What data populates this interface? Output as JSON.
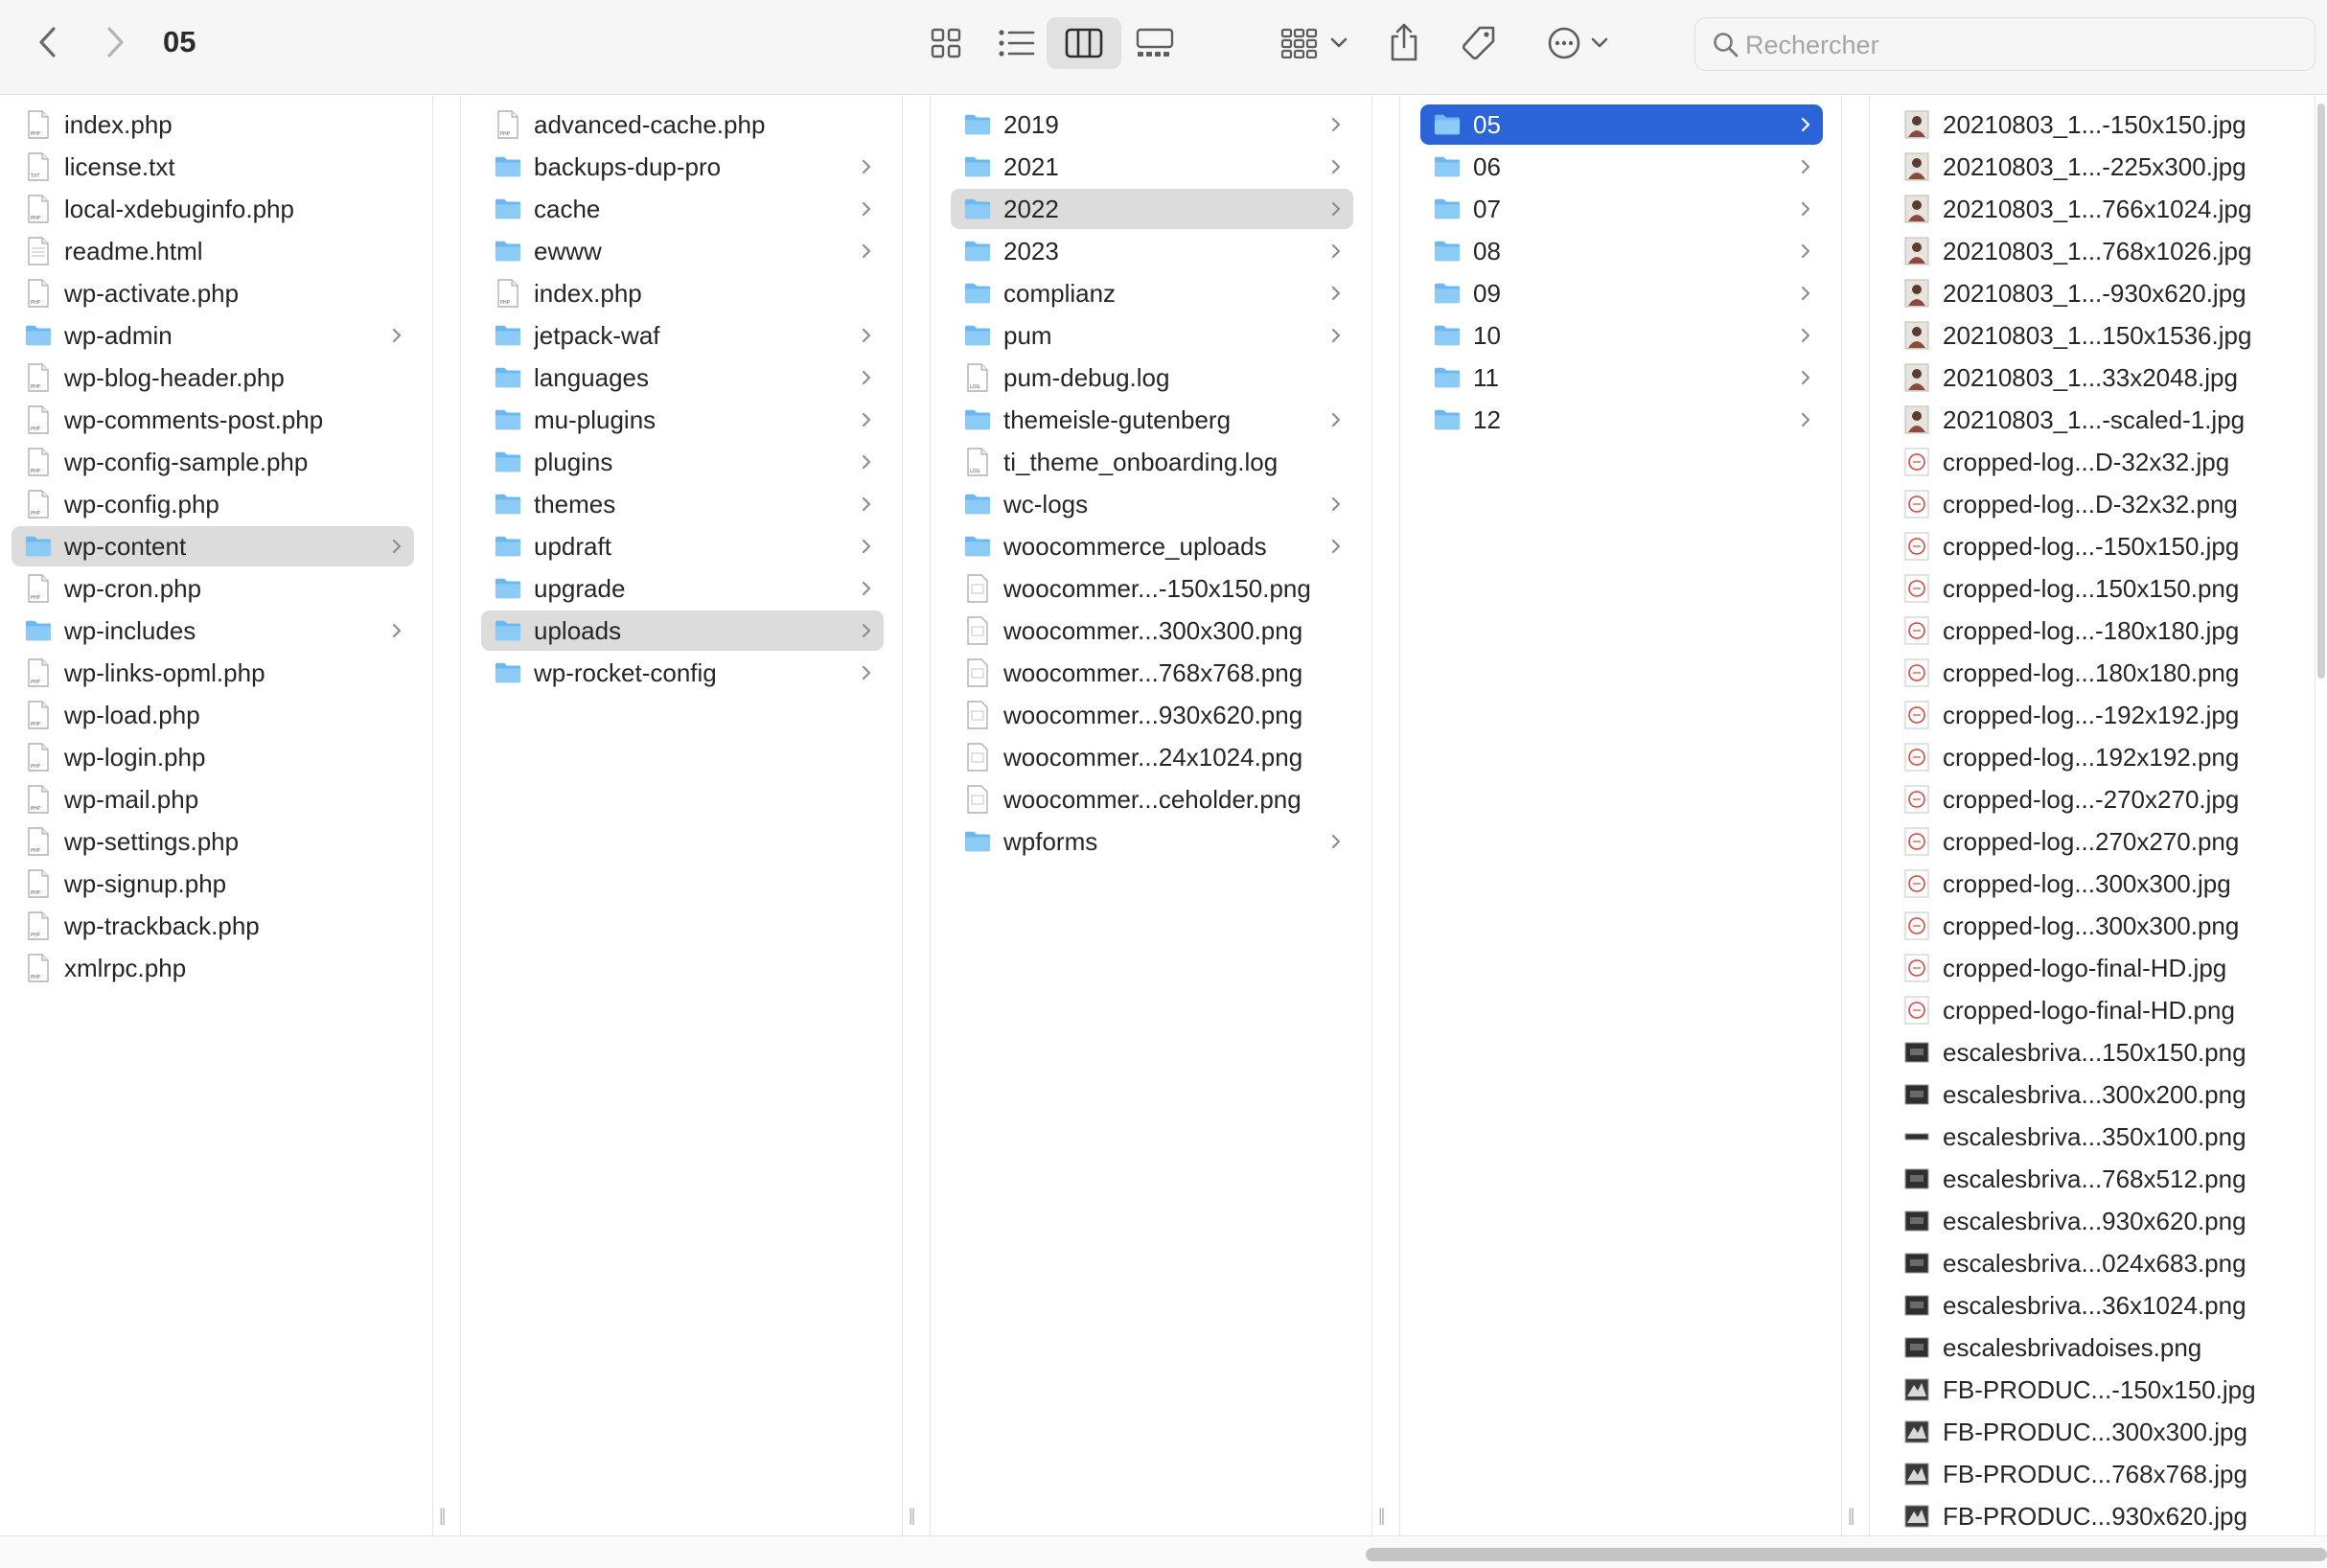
{
  "window": {
    "title": "05"
  },
  "toolbar": {
    "search_placeholder": "Rechercher",
    "view_modes": [
      "icon-view",
      "list-view",
      "column-view",
      "gallery-view"
    ],
    "active_view": "column-view"
  },
  "columns": [
    {
      "items": [
        {
          "name": "index.php",
          "type": "php"
        },
        {
          "name": "license.txt",
          "type": "txt"
        },
        {
          "name": "local-xdebuginfo.php",
          "type": "php"
        },
        {
          "name": "readme.html",
          "type": "html"
        },
        {
          "name": "wp-activate.php",
          "type": "php"
        },
        {
          "name": "wp-admin",
          "type": "folder"
        },
        {
          "name": "wp-blog-header.php",
          "type": "php"
        },
        {
          "name": "wp-comments-post.php",
          "type": "php"
        },
        {
          "name": "wp-config-sample.php",
          "type": "php"
        },
        {
          "name": "wp-config.php",
          "type": "php"
        },
        {
          "name": "wp-content",
          "type": "folder",
          "selected": "gray"
        },
        {
          "name": "wp-cron.php",
          "type": "php"
        },
        {
          "name": "wp-includes",
          "type": "folder"
        },
        {
          "name": "wp-links-opml.php",
          "type": "php"
        },
        {
          "name": "wp-load.php",
          "type": "php"
        },
        {
          "name": "wp-login.php",
          "type": "php"
        },
        {
          "name": "wp-mail.php",
          "type": "php"
        },
        {
          "name": "wp-settings.php",
          "type": "php"
        },
        {
          "name": "wp-signup.php",
          "type": "php"
        },
        {
          "name": "wp-trackback.php",
          "type": "php"
        },
        {
          "name": "xmlrpc.php",
          "type": "php"
        }
      ]
    },
    {
      "items": [
        {
          "name": "advanced-cache.php",
          "type": "php"
        },
        {
          "name": "backups-dup-pro",
          "type": "folder"
        },
        {
          "name": "cache",
          "type": "folder"
        },
        {
          "name": "ewww",
          "type": "folder"
        },
        {
          "name": "index.php",
          "type": "php"
        },
        {
          "name": "jetpack-waf",
          "type": "folder"
        },
        {
          "name": "languages",
          "type": "folder"
        },
        {
          "name": "mu-plugins",
          "type": "folder"
        },
        {
          "name": "plugins",
          "type": "folder"
        },
        {
          "name": "themes",
          "type": "folder"
        },
        {
          "name": "updraft",
          "type": "folder"
        },
        {
          "name": "upgrade",
          "type": "folder"
        },
        {
          "name": "uploads",
          "type": "folder",
          "selected": "gray"
        },
        {
          "name": "wp-rocket-config",
          "type": "folder"
        }
      ]
    },
    {
      "items": [
        {
          "name": "2019",
          "type": "folder"
        },
        {
          "name": "2021",
          "type": "folder"
        },
        {
          "name": "2022",
          "type": "folder",
          "selected": "gray"
        },
        {
          "name": "2023",
          "type": "folder"
        },
        {
          "name": "complianz",
          "type": "folder"
        },
        {
          "name": "pum",
          "type": "folder"
        },
        {
          "name": "pum-debug.log",
          "type": "log"
        },
        {
          "name": "themeisle-gutenberg",
          "type": "folder"
        },
        {
          "name": "ti_theme_onboarding.log",
          "type": "log"
        },
        {
          "name": "wc-logs",
          "type": "folder"
        },
        {
          "name": "woocommerce_uploads",
          "type": "folder"
        },
        {
          "name": "woocommer...-150x150.png",
          "type": "png"
        },
        {
          "name": "woocommer...300x300.png",
          "type": "png"
        },
        {
          "name": "woocommer...768x768.png",
          "type": "png"
        },
        {
          "name": "woocommer...930x620.png",
          "type": "png"
        },
        {
          "name": "woocommer...24x1024.png",
          "type": "png"
        },
        {
          "name": "woocommer...ceholder.png",
          "type": "png"
        },
        {
          "name": "wpforms",
          "type": "folder"
        }
      ]
    },
    {
      "items": [
        {
          "name": "05",
          "type": "folder",
          "selected": "blue"
        },
        {
          "name": "06",
          "type": "folder"
        },
        {
          "name": "07",
          "type": "folder"
        },
        {
          "name": "08",
          "type": "folder"
        },
        {
          "name": "09",
          "type": "folder"
        },
        {
          "name": "10",
          "type": "folder"
        },
        {
          "name": "11",
          "type": "folder"
        },
        {
          "name": "12",
          "type": "folder"
        }
      ]
    },
    {
      "items": [
        {
          "name": "20210803_1...-150x150.jpg",
          "type": "photo"
        },
        {
          "name": "20210803_1...-225x300.jpg",
          "type": "photo"
        },
        {
          "name": "20210803_1...766x1024.jpg",
          "type": "photo"
        },
        {
          "name": "20210803_1...768x1026.jpg",
          "type": "photo"
        },
        {
          "name": "20210803_1...-930x620.jpg",
          "type": "photo"
        },
        {
          "name": "20210803_1...150x1536.jpg",
          "type": "photo"
        },
        {
          "name": "20210803_1...33x2048.jpg",
          "type": "photo"
        },
        {
          "name": "20210803_1...-scaled-1.jpg",
          "type": "photo"
        },
        {
          "name": "cropped-log...D-32x32.jpg",
          "type": "logo"
        },
        {
          "name": "cropped-log...D-32x32.png",
          "type": "logo"
        },
        {
          "name": "cropped-log...-150x150.jpg",
          "type": "logo"
        },
        {
          "name": "cropped-log...150x150.png",
          "type": "logo"
        },
        {
          "name": "cropped-log...-180x180.jpg",
          "type": "logo"
        },
        {
          "name": "cropped-log...180x180.png",
          "type": "logo"
        },
        {
          "name": "cropped-log...-192x192.jpg",
          "type": "logo"
        },
        {
          "name": "cropped-log...192x192.png",
          "type": "logo"
        },
        {
          "name": "cropped-log...-270x270.jpg",
          "type": "logo"
        },
        {
          "name": "cropped-log...270x270.png",
          "type": "logo"
        },
        {
          "name": "cropped-log...300x300.jpg",
          "type": "logo"
        },
        {
          "name": "cropped-log...300x300.png",
          "type": "logo"
        },
        {
          "name": "cropped-logo-final-HD.jpg",
          "type": "logo"
        },
        {
          "name": "cropped-logo-final-HD.png",
          "type": "logo"
        },
        {
          "name": "escalesbriva...150x150.png",
          "type": "dark"
        },
        {
          "name": "escalesbriva...300x200.png",
          "type": "dark"
        },
        {
          "name": "escalesbriva...350x100.png",
          "type": "darkwide"
        },
        {
          "name": "escalesbriva...768x512.png",
          "type": "dark"
        },
        {
          "name": "escalesbriva...930x620.png",
          "type": "dark"
        },
        {
          "name": "escalesbriva...024x683.png",
          "type": "dark"
        },
        {
          "name": "escalesbriva...36x1024.png",
          "type": "dark"
        },
        {
          "name": "escalesbrivadoises.png",
          "type": "dark"
        },
        {
          "name": "FB-PRODUC...-150x150.jpg",
          "type": "fb"
        },
        {
          "name": "FB-PRODUC...300x300.jpg",
          "type": "fb"
        },
        {
          "name": "FB-PRODUC...768x768.jpg",
          "type": "fb"
        },
        {
          "name": "FB-PRODUC...930x620.jpg",
          "type": "fb"
        }
      ]
    }
  ],
  "colors": {
    "folder": "#6cb8f0",
    "selection_blue": "#2b63d9",
    "selection_gray": "#dcdcdc"
  }
}
